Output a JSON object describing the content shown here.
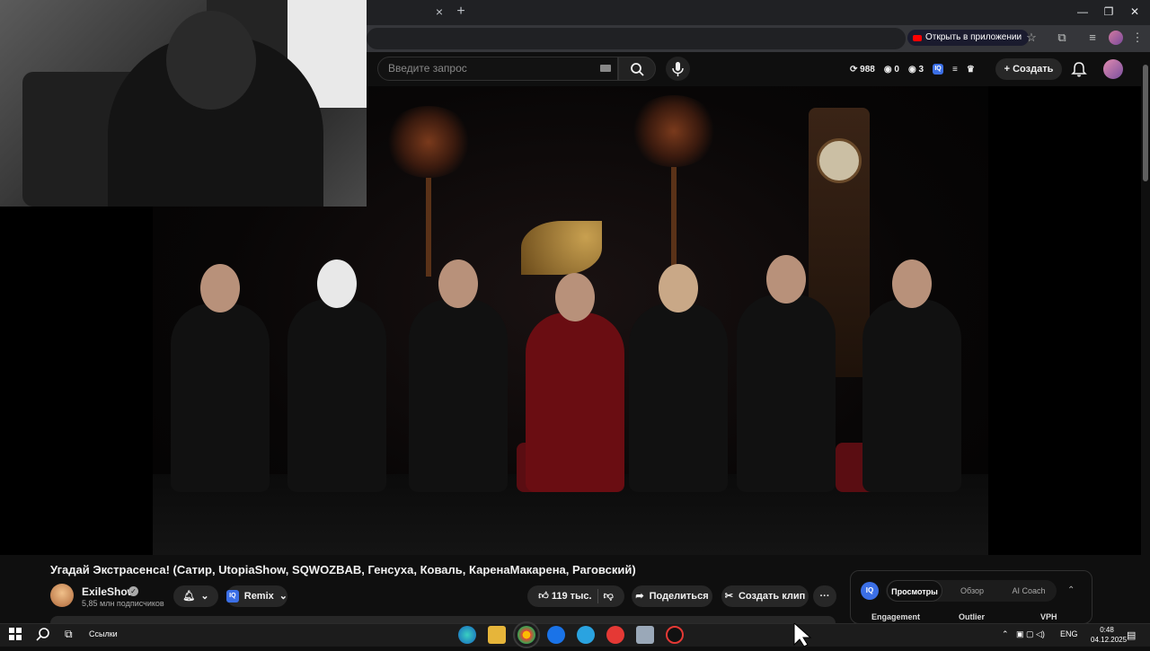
{
  "browser": {
    "tab_close": "×",
    "tab_new": "+",
    "open_in_app": "Открыть в приложении",
    "window_buttons": [
      "—",
      "❐",
      "✕"
    ]
  },
  "youtube": {
    "search_placeholder": "Введите запрос",
    "stats": {
      "likes": "988",
      "views_a": "0",
      "views_b": "3"
    },
    "create_label": "Создать",
    "video": {
      "title": "Угадай Экстрасенса! (Сатир, UtopiaShow, SQWOZBAB, Генсуха, Коваль, КаренаМакарена, Раговский)",
      "channel": "ExileShow",
      "subscribers": "5,85 млн подписчиков",
      "remix_label": "Remix",
      "likes": "119 тыс.",
      "share_label": "Поделиться",
      "clip_label": "Создать клип",
      "more_label": "···"
    }
  },
  "iq_panel": {
    "logo": "IQ",
    "tabs": [
      "Просмотры",
      "Обзор",
      "AI Coach"
    ],
    "active_tab": 0,
    "columns": [
      "Engagement",
      "Outlier",
      "VPH"
    ]
  },
  "taskbar": {
    "search_label": "Ссылки",
    "lang": "ENG",
    "time": "0:48",
    "date": "04.12.2025"
  },
  "colors": {
    "accent": "#3b6fe6",
    "youtube_red": "#ff0000",
    "background": "#0f0f0f"
  }
}
